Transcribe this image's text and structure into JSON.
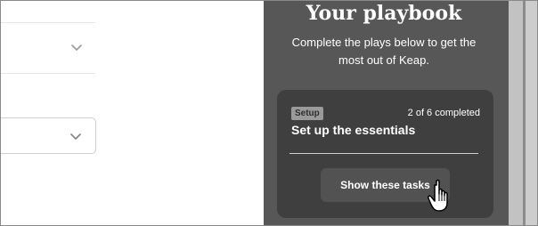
{
  "playbook": {
    "title": "Your playbook",
    "subtitle": "Complete the plays below to get the most out of Keap.",
    "card": {
      "badge": "Setup",
      "progress": "2 of 6 completed",
      "title": "Set up the essentials",
      "button_label": "Show these tasks"
    }
  },
  "icons": {
    "dropdown": "chevron-down-icon",
    "pointer": "hand-pointer-icon"
  },
  "colors": {
    "panel_bg": "#575757",
    "card_bg": "#3f3f3f",
    "button_bg": "#525252",
    "badge_bg": "#9a9a9a"
  }
}
